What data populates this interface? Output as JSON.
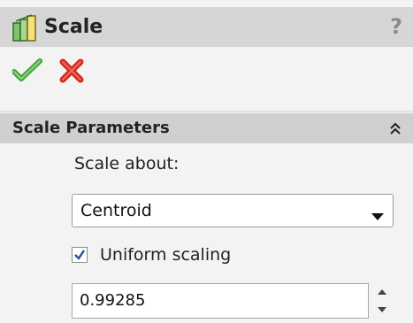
{
  "panel": {
    "title": "Scale",
    "help_glyph": "?"
  },
  "icons": {
    "title": "scale-feature-icon",
    "ok": "checkmark-icon",
    "cancel": "cross-icon",
    "collapse": "double-chevron-up-icon",
    "dropdown": "triangle-down-icon",
    "spin_up": "spin-up-icon",
    "spin_down": "spin-down-icon"
  },
  "section": {
    "title": "Scale Parameters"
  },
  "scale_about": {
    "label": "Scale about:",
    "selected": "Centroid"
  },
  "uniform_scaling": {
    "label": "Uniform scaling",
    "checked": true
  },
  "scale_factor": {
    "value": "0.99285"
  },
  "colors": {
    "titlebar": "#d6d6d6",
    "section_header": "#d0d0d0",
    "ok_green": "#3fa33a",
    "cancel_red": "#d42a1e",
    "icon_green": "#3c9a3a"
  }
}
